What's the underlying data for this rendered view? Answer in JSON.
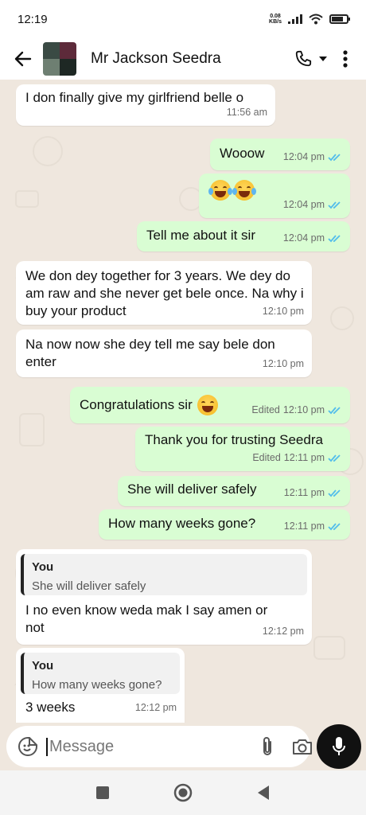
{
  "status_bar": {
    "time": "12:19",
    "net_speed_value": "0.08",
    "net_speed_unit": "KB/s",
    "battery_level": 0.75
  },
  "header": {
    "contact_name": "Mr Jackson Seedra"
  },
  "messages": [
    {
      "dir": "in",
      "text": "I don finally give my girlfriend belle o",
      "time": "11:56 am"
    },
    {
      "dir": "out",
      "text": "Wooow",
      "time": "12:04 pm"
    },
    {
      "dir": "out",
      "emoji": "face-with-tears-of-joy",
      "time": "12:04 pm"
    },
    {
      "dir": "out",
      "text": "Tell me about it sir",
      "time": "12:04 pm"
    },
    {
      "dir": "in",
      "text": "We don dey together for 3 years. We dey do am raw and she never get bele once. Na why i buy your product",
      "time": "12:10 pm"
    },
    {
      "dir": "in",
      "text": "Na now now she dey tell me say bele don enter",
      "time": "12:10 pm"
    },
    {
      "dir": "out",
      "text": "Congratulations sir",
      "emoji": "grinning-face-with-sweat",
      "edited": "Edited",
      "time": "12:10 pm"
    },
    {
      "dir": "out",
      "text": "Thank you for trusting Seedra",
      "edited": "Edited",
      "time": "12:11 pm"
    },
    {
      "dir": "out",
      "text": "She will deliver safely",
      "time": "12:11 pm"
    },
    {
      "dir": "out",
      "text": "How many weeks gone?",
      "time": "12:11 pm"
    },
    {
      "dir": "in",
      "quote_author": "You",
      "quote_text": "She will deliver safely",
      "text": "I no even know weda mak I say amen or not",
      "time": "12:12 pm"
    },
    {
      "dir": "in",
      "quote_author": "You",
      "quote_text": "How many weeks gone?",
      "text": "3 weeks",
      "time": "12:12 pm"
    }
  ],
  "composer": {
    "placeholder": "Message"
  },
  "colors": {
    "outgoing": "#d9fdd3",
    "incoming": "#ffffff",
    "chat_bg": "#efe7de",
    "read_tick": "#53bdeb"
  }
}
